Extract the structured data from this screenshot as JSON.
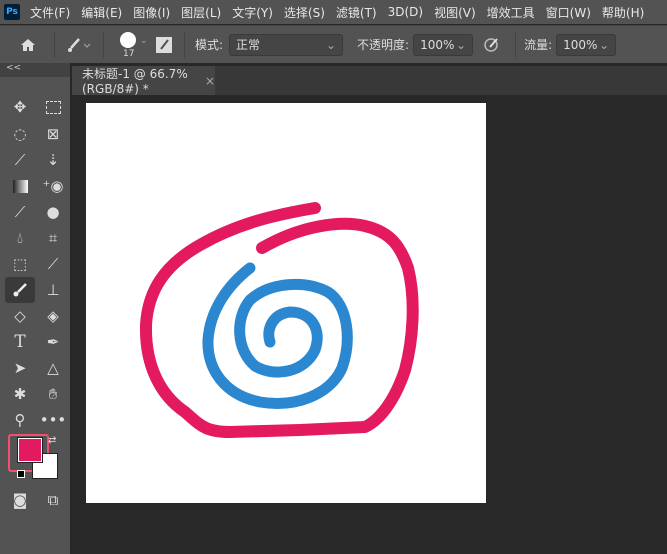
{
  "app": {
    "logo": "Ps"
  },
  "menu": [
    "文件(F)",
    "编辑(E)",
    "图像(I)",
    "图层(L)",
    "文字(Y)",
    "选择(S)",
    "滤镜(T)",
    "3D(D)",
    "视图(V)",
    "增效工具",
    "窗口(W)",
    "帮助(H)"
  ],
  "options": {
    "brush_size": "17",
    "mode_label": "模式:",
    "mode_value": "正常",
    "opacity_label": "不透明度:",
    "opacity_value": "100%",
    "flow_label": "流量:",
    "flow_value": "100%"
  },
  "tabs_toggle": "<<",
  "document_tab": {
    "title": "未标题-1 @ 66.7%(RGB/8#) *",
    "close": "×"
  },
  "colors": {
    "foreground": "#e31a5f",
    "background": "#ffffff",
    "pink_stroke": "#e31a5f",
    "blue_stroke": "#2b88d0"
  },
  "tools": [
    "move",
    "marquee",
    "lasso",
    "frame",
    "quick-select",
    "vertical-type-mask",
    "gradient",
    "red-eye",
    "eyedropper",
    "blob",
    "blur",
    "crop",
    "object-select",
    "color-sampler",
    "brush",
    "stamp",
    "eraser",
    "paint-bucket",
    "type",
    "pen",
    "path-select",
    "shape",
    "puppet",
    "hand",
    "zoom",
    "more"
  ],
  "tool_glyphs": {
    "type": "T"
  }
}
